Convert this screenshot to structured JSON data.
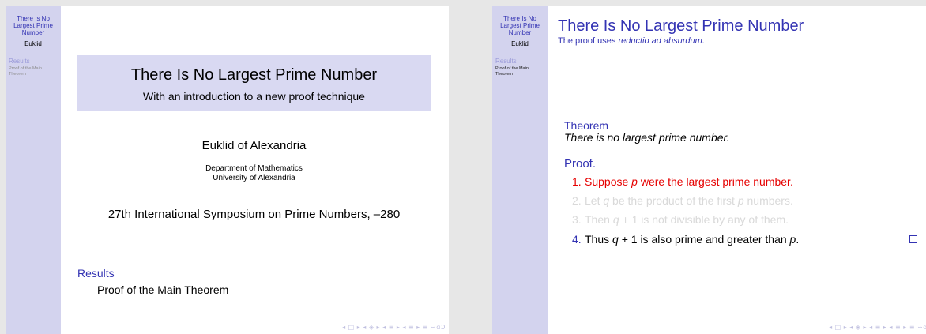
{
  "sidebar": {
    "title": "There Is No Largest Prime Number",
    "author": "Euklid",
    "section": "Results",
    "subsection": "Proof of the Main Theorem"
  },
  "slide1": {
    "title": "There Is No Largest Prime Number",
    "subtitle": "With an introduction to a new proof technique",
    "author": "Euklid of Alexandria",
    "department": "Department of Mathematics",
    "university": "University of Alexandria",
    "conference": "27th International Symposium on Prime Numbers, –280",
    "toc_section": "Results",
    "toc_subsection": "Proof of the Main Theorem"
  },
  "slide2": {
    "title": "There Is No Largest Prime Number",
    "subtitle_prefix": "The proof uses ",
    "subtitle_emph": "reductio ad absurdum.",
    "theorem_label": "Theorem",
    "theorem_text": "There is no largest prime number.",
    "proof_label": "Proof.",
    "steps": [
      {
        "num": "1.",
        "text": "Suppose p were the largest prime number."
      },
      {
        "num": "2.",
        "text": "Let q be the product of the first p numbers."
      },
      {
        "num": "3.",
        "text": "Then q + 1 is not divisible by any of them."
      },
      {
        "num": "4.",
        "text": "Thus q + 1 is also prime and greater than p."
      }
    ]
  },
  "nav_symbols": "◂ □ ▸ ◂ ◈ ▸ ◂ ≡ ▸ ◂ ≡ ▸ ≡ ∽ɑƆ",
  "colors": {
    "sidebar": "#d3d3ee",
    "structure": "#3333b3",
    "alert": "#e60000",
    "covered": "#d9d9d9"
  }
}
